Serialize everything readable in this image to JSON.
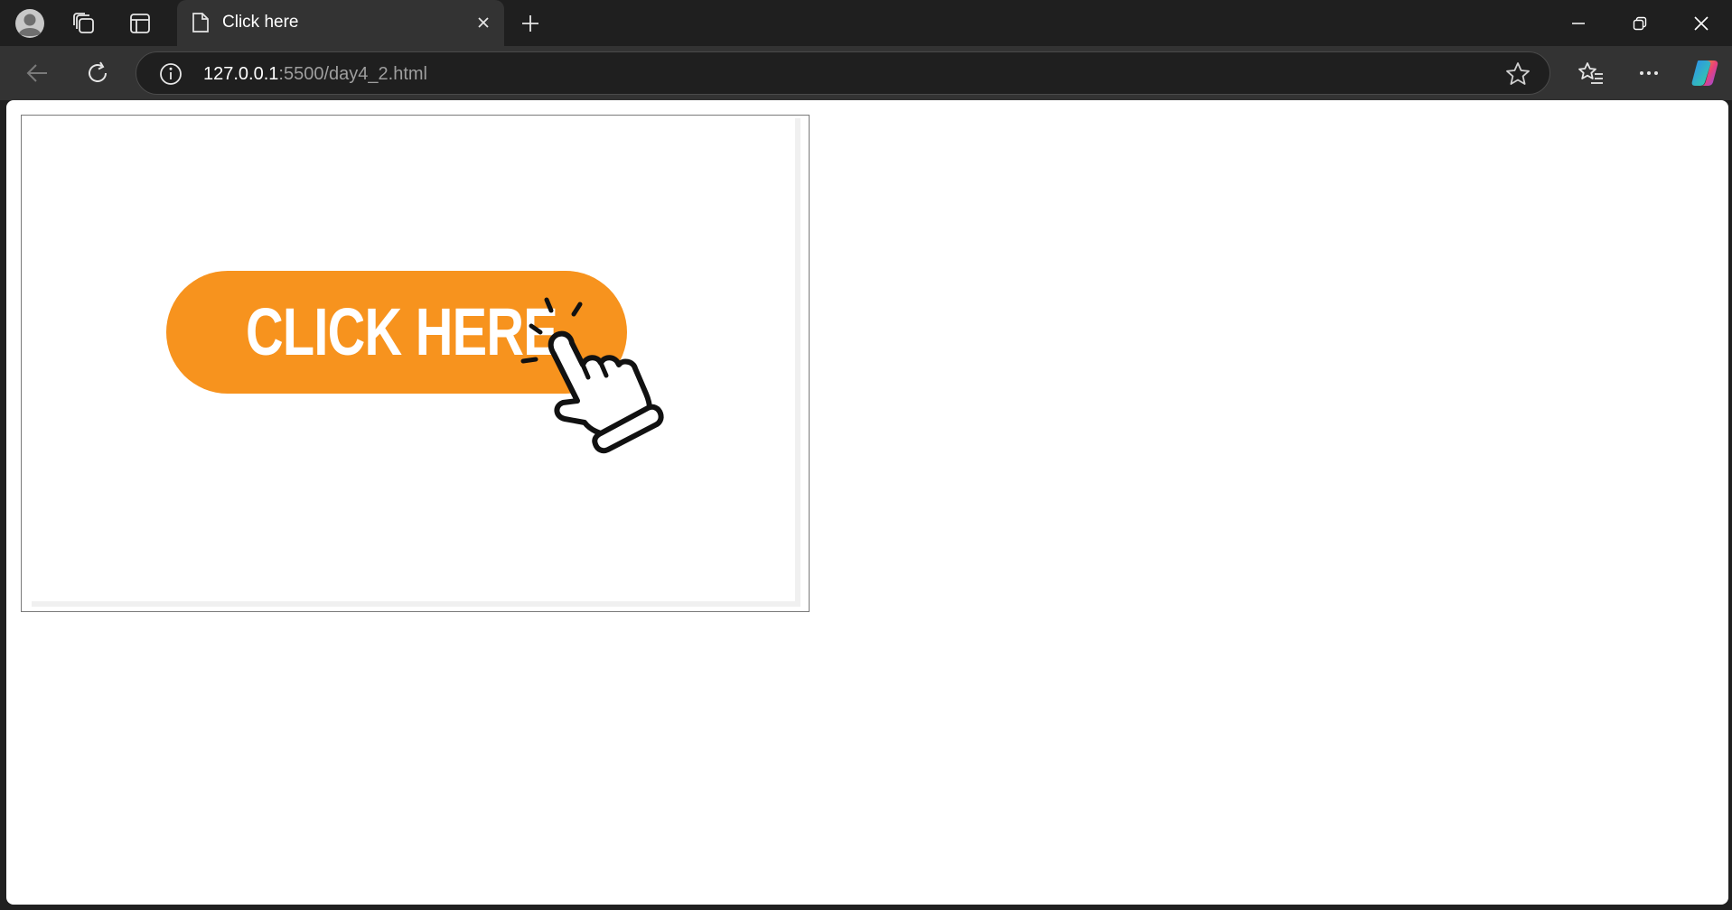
{
  "tab": {
    "title": "Click here"
  },
  "address_bar": {
    "host": "127.0.0.1",
    "path": ":5500/day4_2.html"
  },
  "page": {
    "image_text": "CLICK HERE"
  },
  "colors": {
    "button_orange": "#f7931e",
    "chrome_dark": "#1f1f1f",
    "toolbar": "#333333"
  },
  "icons": {
    "profile": "avatar-icon",
    "workspaces": "workspaces-icon",
    "tab_actions": "vertical-tabs-icon",
    "page": "page-icon",
    "close": "close-icon",
    "new_tab": "plus-icon",
    "minimize": "minimize-icon",
    "restore": "restore-icon",
    "window_close": "window-close-icon",
    "back": "back-arrow-icon",
    "refresh": "refresh-icon",
    "info": "info-icon",
    "favorite": "star-icon",
    "favorites": "favorites-icon",
    "more": "more-icon",
    "copilot": "copilot-icon"
  }
}
